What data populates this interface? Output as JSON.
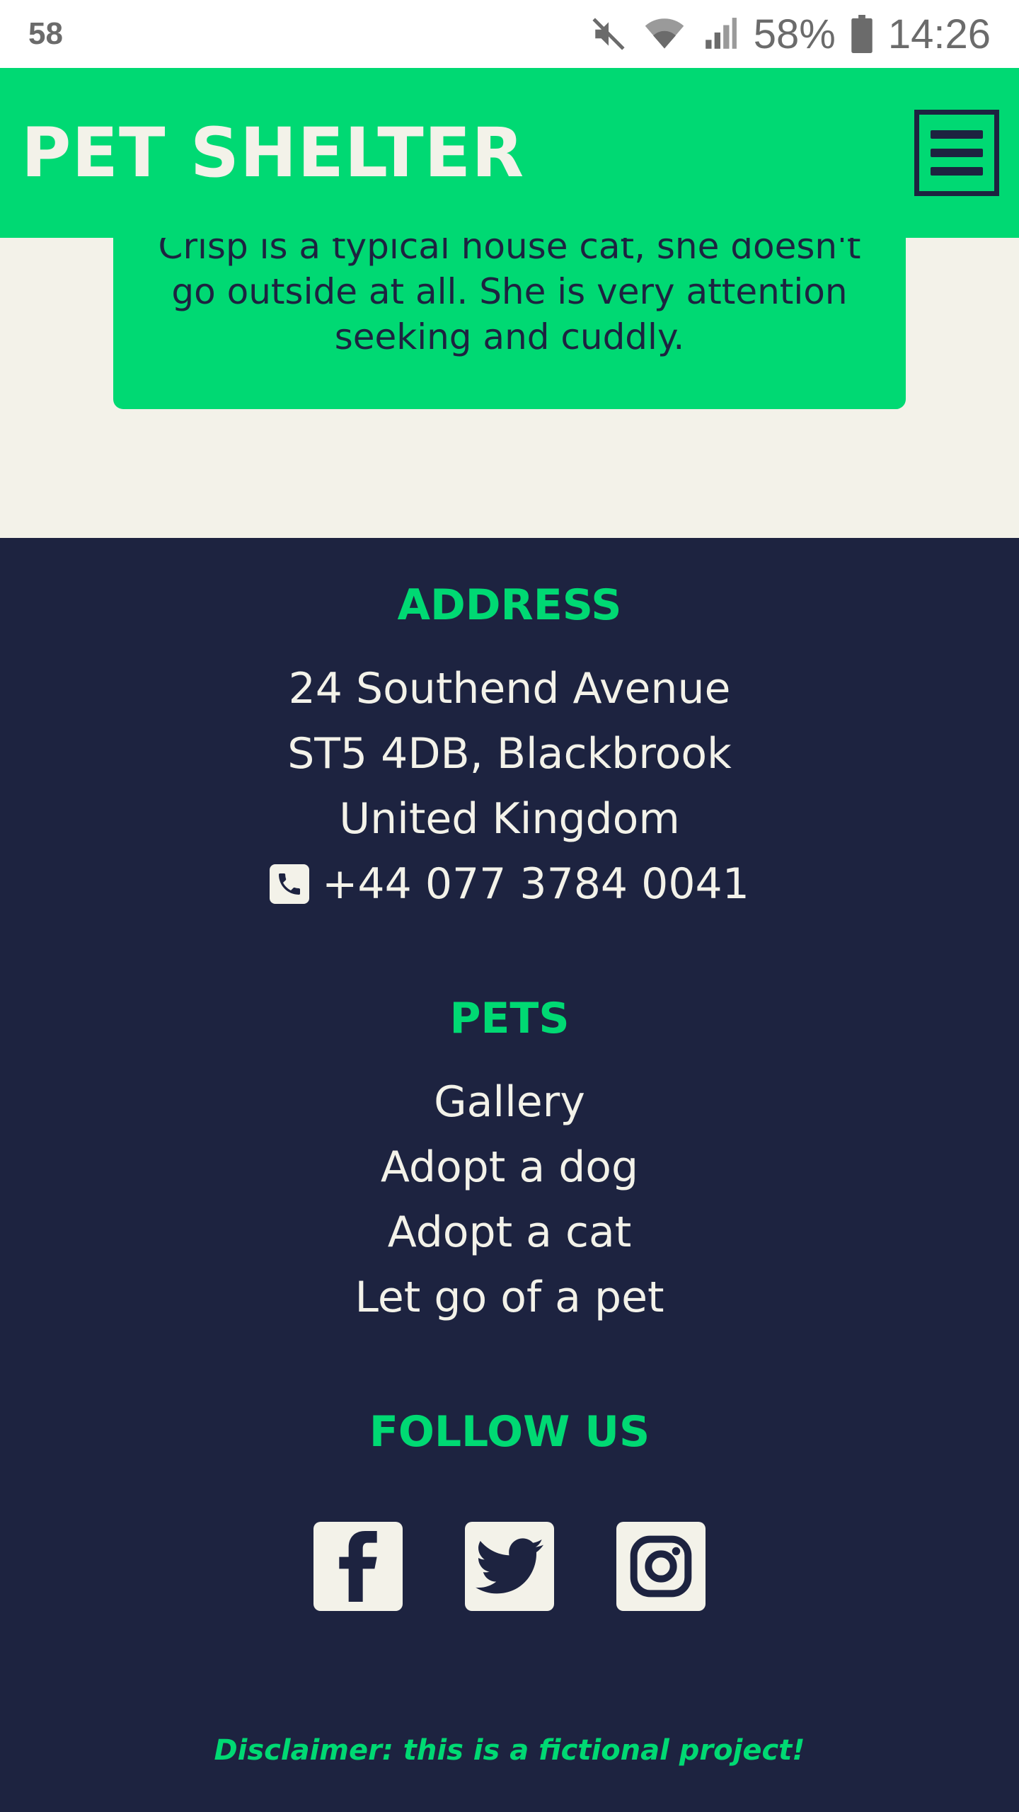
{
  "status_bar": {
    "left_text": "58",
    "battery": "58%",
    "time": "14:26",
    "icons": [
      "mute-icon",
      "wifi-icon",
      "signal-icon",
      "battery-icon"
    ]
  },
  "header": {
    "brand": "PET SHELTER",
    "menu_icon": "hamburger-icon"
  },
  "pet_card": {
    "description_lines": [
      "Crisp is a typical house cat, she doesn't",
      "go outside at all. She is very attention",
      "seeking and cuddly."
    ]
  },
  "footer": {
    "address": {
      "title": "ADDRESS",
      "line1": "24 Southend Avenue",
      "line2": "ST5 4DB, Blackbrook",
      "line3": "United Kingdom",
      "phone": "+44 077 3784 0041"
    },
    "pets": {
      "title": "PETS",
      "links": [
        "Gallery",
        "Adopt a dog",
        "Adopt a cat",
        "Let go of a pet"
      ]
    },
    "follow": {
      "title": "FOLLOW US",
      "icons": [
        "facebook-icon",
        "twitter-icon",
        "instagram-icon"
      ]
    },
    "disclaimer": "Disclaimer: this is a fictional project!"
  },
  "colors": {
    "accent": "#00d973",
    "navy": "#1d2340",
    "cream": "#f3f2e9"
  }
}
